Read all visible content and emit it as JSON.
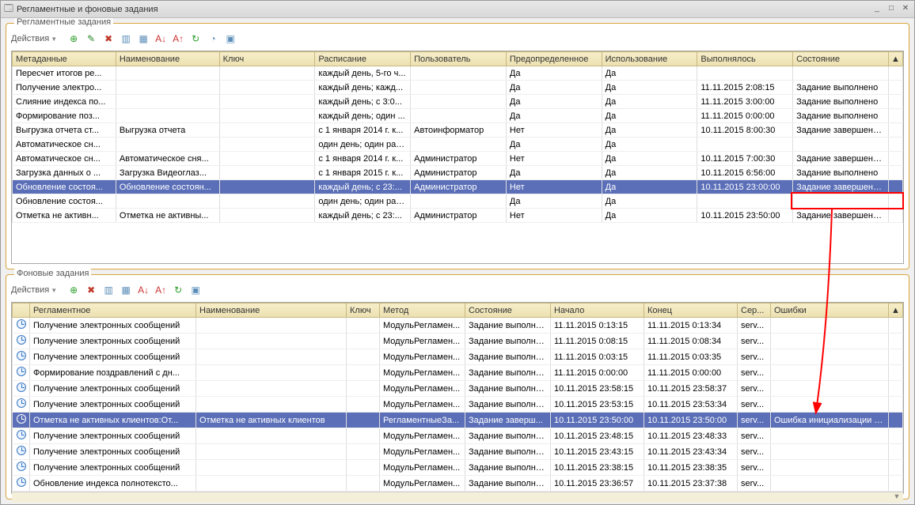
{
  "window": {
    "title": "Регламентные и фоновые задания"
  },
  "group1": {
    "title": "Регламентные задания",
    "toolbar": {
      "actions": "Действия"
    },
    "headers": [
      "Метаданные",
      "Наименование",
      "Ключ",
      "Расписание",
      "Пользователь",
      "Предопределенное",
      "Использование",
      "Выполнялось",
      "Состояние"
    ],
    "rows": [
      {
        "c": [
          "Пересчет итогов ре...",
          "",
          "",
          "каждый  день, 5-го ч...",
          "",
          "Да",
          "Да",
          "",
          ""
        ],
        "sel": false
      },
      {
        "c": [
          "Получение электро...",
          "",
          "",
          "каждый  день; кажд...",
          "",
          "Да",
          "Да",
          "11.11.2015 2:08:15",
          "Задание выполнено"
        ],
        "sel": false
      },
      {
        "c": [
          "Слияние индекса по...",
          "",
          "",
          "каждый  день; с 3:0...",
          "",
          "Да",
          "Да",
          "11.11.2015 3:00:00",
          "Задание выполнено"
        ],
        "sel": false
      },
      {
        "c": [
          "Формирование поз...",
          "",
          "",
          "каждый  день; один ...",
          "",
          "Да",
          "Да",
          "11.11.2015 0:00:00",
          "Задание выполнено"
        ],
        "sel": false
      },
      {
        "c": [
          "Выгрузка отчета ст...",
          "Выгрузка отчета",
          "",
          "с 1 января 2014 г. к...",
          "Автоинформатор",
          "Нет",
          "Да",
          "10.11.2015 8:00:30",
          "Задание завершено ..."
        ],
        "sel": false
      },
      {
        "c": [
          "Автоматическое сн...",
          "",
          "",
          "один день; один раз...",
          "",
          "Да",
          "Да",
          "",
          ""
        ],
        "sel": false
      },
      {
        "c": [
          "Автоматическое сн...",
          "Автоматическое сня...",
          "",
          "с 1 января 2014 г. к...",
          "Администратор",
          "Нет",
          "Да",
          "10.11.2015 7:00:30",
          "Задание завершено ..."
        ],
        "sel": false
      },
      {
        "c": [
          "Загрузка данных о ...",
          "Загрузка Видеоглаз...",
          "",
          "с 1 января 2015 г. к...",
          "Администратор",
          "Да",
          "Да",
          "10.11.2015 6:56:00",
          "Задание выполнено"
        ],
        "sel": false
      },
      {
        "c": [
          "Обновление состоя...",
          "Обновление состоян...",
          "",
          "каждый  день; с 23:...",
          "Администратор",
          "Нет",
          "Да",
          "10.11.2015 23:00:00",
          "Задание завершено ..."
        ],
        "sel": true
      },
      {
        "c": [
          "Обновление состоя...",
          "",
          "",
          "один день; один раз...",
          "",
          "Да",
          "Да",
          "",
          ""
        ],
        "sel": false
      },
      {
        "c": [
          "Отметка не активн...",
          "Отметка не активны...",
          "",
          "каждый  день; с 23:...",
          "Администратор",
          "Нет",
          "Да",
          "10.11.2015 23:50:00",
          "Задание завершено ..."
        ],
        "sel": false
      }
    ]
  },
  "group2": {
    "title": "Фоновые задания",
    "toolbar": {
      "actions": "Действия"
    },
    "headers": [
      "",
      "Регламентное",
      "Наименование",
      "Ключ",
      "Метод",
      "Состояние",
      "Начало",
      "Конец",
      "Сер...",
      "Ошибки"
    ],
    "rows": [
      {
        "c": [
          "Получение электронных сообщений",
          "",
          "",
          "МодульРегламен...",
          "Задание выполне...",
          "11.11.2015 0:13:15",
          "11.11.2015 0:13:34",
          "serv...",
          ""
        ],
        "sel": false
      },
      {
        "c": [
          "Получение электронных сообщений",
          "",
          "",
          "МодульРегламен...",
          "Задание выполне...",
          "11.11.2015 0:08:15",
          "11.11.2015 0:08:34",
          "serv...",
          ""
        ],
        "sel": false
      },
      {
        "c": [
          "Получение электронных сообщений",
          "",
          "",
          "МодульРегламен...",
          "Задание выполне...",
          "11.11.2015 0:03:15",
          "11.11.2015 0:03:35",
          "serv...",
          ""
        ],
        "sel": false
      },
      {
        "c": [
          "Формирование поздравлений с дн...",
          "",
          "",
          "МодульРегламен...",
          "Задание выполне...",
          "11.11.2015 0:00:00",
          "11.11.2015 0:00:00",
          "serv...",
          ""
        ],
        "sel": false
      },
      {
        "c": [
          "Получение электронных сообщений",
          "",
          "",
          "МодульРегламен...",
          "Задание выполне...",
          "10.11.2015 23:58:15",
          "10.11.2015 23:58:37",
          "serv...",
          ""
        ],
        "sel": false
      },
      {
        "c": [
          "Получение электронных сообщений",
          "",
          "",
          "МодульРегламен...",
          "Задание выполне...",
          "10.11.2015 23:53:15",
          "10.11.2015 23:53:34",
          "serv...",
          ""
        ],
        "sel": false
      },
      {
        "c": [
          "Отметка не активных клиентов:От...",
          "Отметка не активных клиентов",
          "",
          "РегламентныеЗа...",
          "Задание заверш...",
          "10.11.2015 23:50:00",
          "10.11.2015 23:50:00",
          "serv...",
          "Ошибка инициализации библи..."
        ],
        "sel": true
      },
      {
        "c": [
          "Получение электронных сообщений",
          "",
          "",
          "МодульРегламен...",
          "Задание выполне...",
          "10.11.2015 23:48:15",
          "10.11.2015 23:48:33",
          "serv...",
          ""
        ],
        "sel": false
      },
      {
        "c": [
          "Получение электронных сообщений",
          "",
          "",
          "МодульРегламен...",
          "Задание выполне...",
          "10.11.2015 23:43:15",
          "10.11.2015 23:43:34",
          "serv...",
          ""
        ],
        "sel": false
      },
      {
        "c": [
          "Получение электронных сообщений",
          "",
          "",
          "МодульРегламен...",
          "Задание выполне...",
          "10.11.2015 23:38:15",
          "10.11.2015 23:38:35",
          "serv...",
          ""
        ],
        "sel": false
      },
      {
        "c": [
          "Обновление индекса полнотексто...",
          "",
          "",
          "МодульРегламен...",
          "Задание выполне...",
          "10.11.2015 23:36:57",
          "10.11.2015 23:37:38",
          "serv...",
          ""
        ],
        "sel": false
      }
    ]
  }
}
